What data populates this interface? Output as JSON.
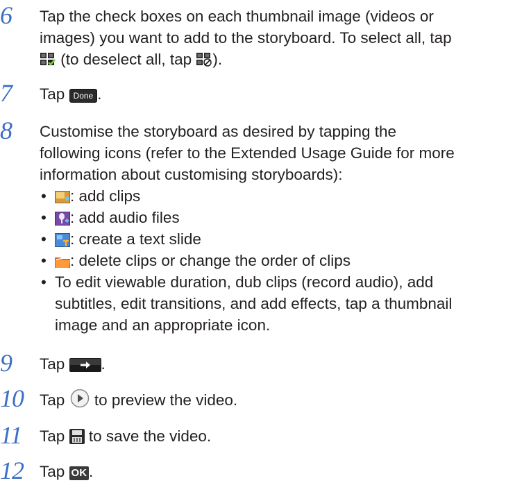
{
  "steps": {
    "s6": {
      "number": "6",
      "line1": "Tap the check boxes on each thumbnail image (videos or",
      "line2": "images) you want to add to the storyboard. To select all, tap",
      "part_a": "(to deselect all, tap",
      "part_b": ")."
    },
    "s7": {
      "number": "7",
      "pre": "Tap",
      "button": "Done",
      "post": "."
    },
    "s8": {
      "number": "8",
      "line1": "Customise the storyboard as desired by tapping the",
      "line2": "following icons (refer to the Extended Usage Guide for more",
      "line3": "information about customising storyboards):",
      "bullets": [
        {
          "icon": "add-clips-icon",
          "text": ": add clips"
        },
        {
          "icon": "add-audio-icon",
          "text": ": add audio files"
        },
        {
          "icon": "text-slide-icon",
          "text": ": create a text slide"
        },
        {
          "icon": "folder-icon",
          "text": ": delete clips or change the order of clips"
        }
      ],
      "last_bullet": {
        "line1": "To edit viewable duration, dub clips (record audio), add",
        "line2": "subtitles, edit transitions, and add effects, tap a thumbnail",
        "line3": "image and an appropriate icon."
      }
    },
    "s9": {
      "number": "9",
      "pre": "Tap",
      "post": "."
    },
    "s10": {
      "number": "10",
      "pre": "Tap",
      "post": "to preview the video."
    },
    "s11": {
      "number": "11",
      "pre": "Tap",
      "post": "to save the video."
    },
    "s12": {
      "number": "12",
      "pre": "Tap",
      "button": "OK",
      "post": "."
    }
  },
  "colors": {
    "step_number": "#3c6fc4",
    "text": "#231f20"
  }
}
